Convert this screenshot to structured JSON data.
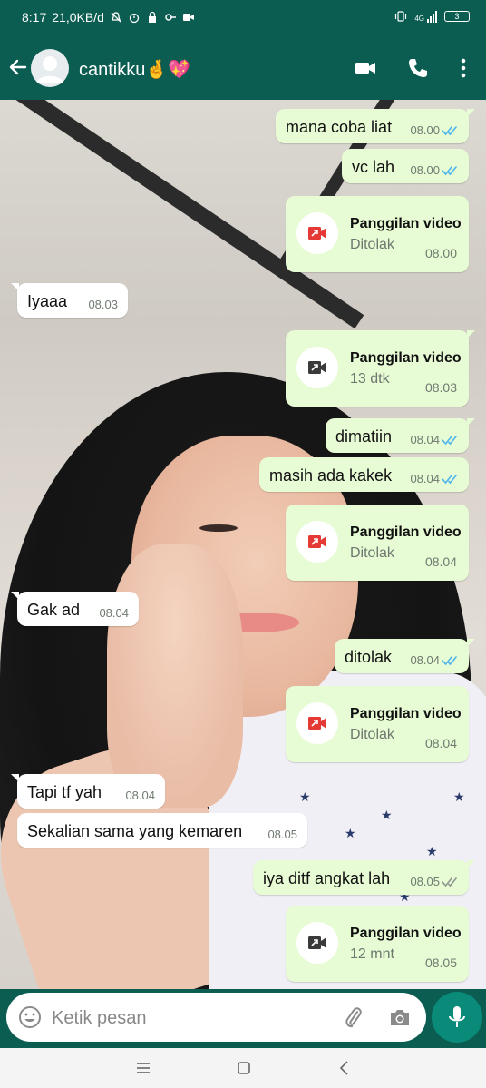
{
  "status_bar": {
    "time": "8:17",
    "network_speed": "21,0KB/d",
    "signal": "4G",
    "battery": "3"
  },
  "header": {
    "contact_name": "cantikku🤞💖",
    "icons": [
      "back-arrow-icon",
      "avatar",
      "video-call-icon",
      "voice-call-icon",
      "more-options-icon"
    ]
  },
  "messages": [
    {
      "dir": "out",
      "kind": "text",
      "text": "mana coba liat",
      "time": "08.00",
      "status": "read"
    },
    {
      "dir": "out",
      "kind": "text",
      "text": "vc lah",
      "time": "08.00",
      "status": "read"
    },
    {
      "dir": "out",
      "kind": "call",
      "title": "Panggilan video",
      "sub": "Ditolak",
      "time": "08.00",
      "call_state": "missed"
    },
    {
      "dir": "in",
      "kind": "text",
      "text": "Iyaaa",
      "time": "08.03"
    },
    {
      "dir": "out",
      "kind": "call",
      "title": "Panggilan video",
      "sub": "13 dtk",
      "time": "08.03",
      "call_state": "answered"
    },
    {
      "dir": "out",
      "kind": "text",
      "text": "dimatiin",
      "time": "08.04",
      "status": "read"
    },
    {
      "dir": "out",
      "kind": "text",
      "text": "masih ada kakek",
      "time": "08.04",
      "status": "read"
    },
    {
      "dir": "out",
      "kind": "call",
      "title": "Panggilan video",
      "sub": "Ditolak",
      "time": "08.04",
      "call_state": "missed"
    },
    {
      "dir": "in",
      "kind": "text",
      "text": "Gak ad",
      "time": "08.04"
    },
    {
      "dir": "out",
      "kind": "text",
      "text": "ditolak",
      "time": "08.04",
      "status": "read"
    },
    {
      "dir": "out",
      "kind": "call",
      "title": "Panggilan video",
      "sub": "Ditolak",
      "time": "08.04",
      "call_state": "missed"
    },
    {
      "dir": "in",
      "kind": "text",
      "text": "Tapi tf yah",
      "time": "08.04"
    },
    {
      "dir": "in",
      "kind": "text",
      "text": "Sekalian sama yang kemaren",
      "time": "08.05"
    },
    {
      "dir": "out",
      "kind": "text",
      "text": "iya ditf angkat lah",
      "time": "08.05",
      "status": "delivered"
    },
    {
      "dir": "out",
      "kind": "call",
      "title": "Panggilan video",
      "sub": "12 mnt",
      "time": "08.05",
      "call_state": "answered"
    }
  ],
  "composer": {
    "placeholder": "Ketik pesan"
  },
  "colors": {
    "header_bg": "#0b5d51",
    "outgoing_bubble": "#e7fbd4",
    "incoming_bubble": "#ffffff",
    "read_ticks": "#4fb6ec",
    "missed_call": "#e53935",
    "mic_button": "#0a8a79"
  }
}
